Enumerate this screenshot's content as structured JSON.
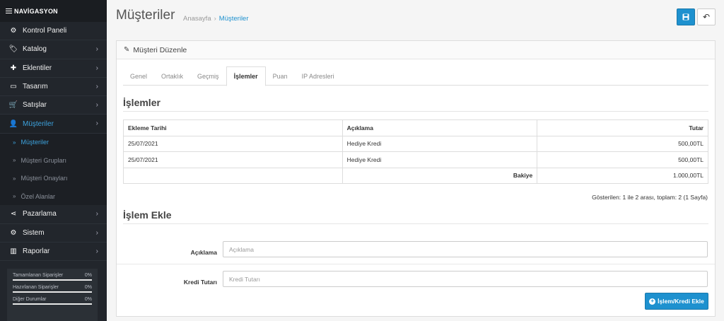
{
  "sidebar": {
    "heading": "NAVİGASYON",
    "items": [
      {
        "label": "Kontrol Paneli",
        "icon": "dashboard-icon",
        "glyph": "⚙",
        "chevron": ""
      },
      {
        "label": "Katalog",
        "icon": "tags-icon",
        "glyph": "🏷",
        "chevron": "›"
      },
      {
        "label": "Eklentiler",
        "icon": "puzzle-icon",
        "glyph": "✚",
        "chevron": "›"
      },
      {
        "label": "Tasarım",
        "icon": "monitor-icon",
        "glyph": "▭",
        "chevron": "›"
      },
      {
        "label": "Satışlar",
        "icon": "cart-icon",
        "glyph": "🛒",
        "chevron": "›"
      },
      {
        "label": "Müşteriler",
        "icon": "user-icon",
        "glyph": "👤",
        "chevron": "›"
      }
    ],
    "subitems": [
      {
        "label": "Müşteriler"
      },
      {
        "label": "Müşteri Grupları"
      },
      {
        "label": "Müşteri Onayları"
      },
      {
        "label": "Özel Alanlar"
      }
    ],
    "items2": [
      {
        "label": "Pazarlama",
        "icon": "share-icon",
        "glyph": "⋖",
        "chevron": "›"
      },
      {
        "label": "Sistem",
        "icon": "cog-icon",
        "glyph": "⚙",
        "chevron": "›"
      },
      {
        "label": "Raporlar",
        "icon": "bar-chart-icon",
        "glyph": "▥",
        "chevron": "›"
      }
    ],
    "progress": [
      {
        "label": "Tamamlanan Siparişler",
        "value": "0%",
        "fraction": 0
      },
      {
        "label": "Hazırlanan Siparişler",
        "value": "0%",
        "fraction": 0
      },
      {
        "label": "Diğer Durumlar",
        "value": "0%",
        "fraction": 0
      }
    ]
  },
  "header": {
    "title": "Müşteriler",
    "breadcrumb_home": "Anasayfa",
    "breadcrumb_sep": "›",
    "breadcrumb_current": "Müşteriler"
  },
  "panel": {
    "title": "Müşteri Düzenle",
    "tabs": [
      {
        "label": "Genel"
      },
      {
        "label": "Ortaklık"
      },
      {
        "label": "Geçmiş"
      },
      {
        "label": "İşlemler"
      },
      {
        "label": "Puan"
      },
      {
        "label": "IP Adresleri"
      }
    ]
  },
  "transactions": {
    "title": "İşlemler",
    "columns": [
      "Ekleme Tarihi",
      "Açıklama",
      "Tutar"
    ],
    "rows": [
      {
        "date": "25/07/2021",
        "desc": "Hediye Kredi",
        "amount": "500,00TL"
      },
      {
        "date": "25/07/2021",
        "desc": "Hediye Kredi",
        "amount": "500,00TL"
      }
    ],
    "balance_label": "Bakiye",
    "balance_value": "1.000,00TL",
    "showing": "Gösterilen: 1 ile 2 arası, toplam: 2 (1 Sayfa)"
  },
  "add_form": {
    "title": "İşlem Ekle",
    "desc_label": "Açıklama",
    "desc_placeholder": "Açıklama",
    "amount_label": "Kredi Tutarı",
    "amount_placeholder": "Kredi Tutarı",
    "submit_label": "İşlem/Kredi Ekle"
  },
  "colors": {
    "accent": "#1e91cf",
    "sidebar_bg": "#22262c",
    "active_link": "#3da3de"
  }
}
